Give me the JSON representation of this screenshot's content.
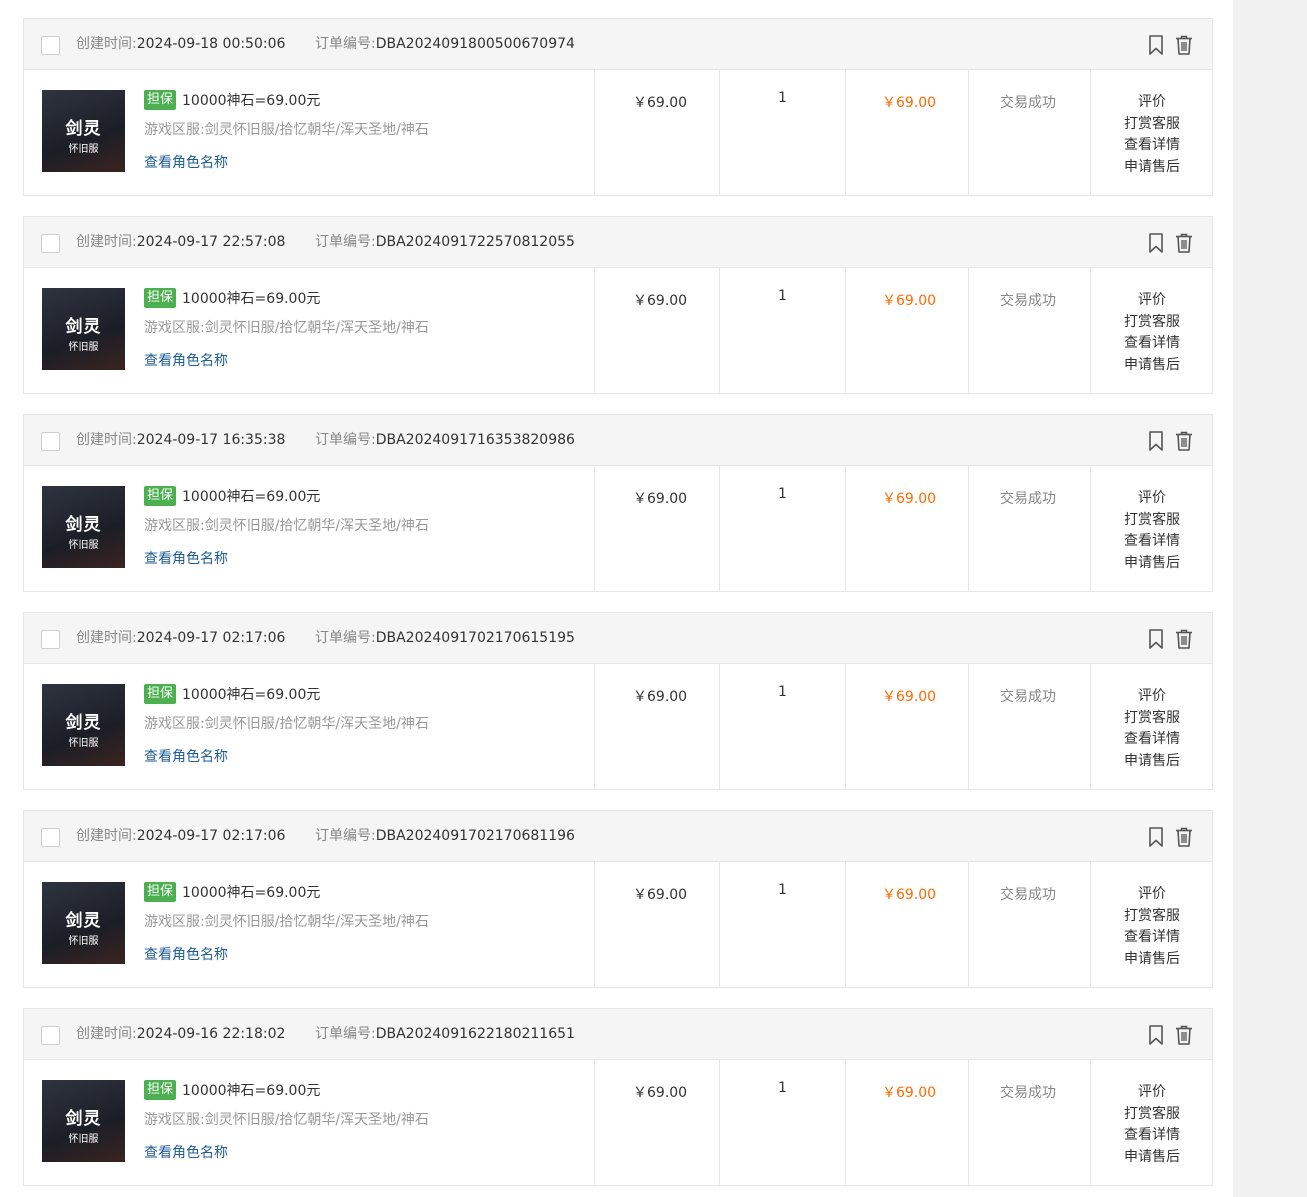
{
  "labels": {
    "created_time": "创建时间:",
    "order_no": "订单编号:",
    "guarantee_badge": "担保",
    "server_prefix": "游戏区服:",
    "view_role": "查看角色名称",
    "thumb_line1": "剑灵",
    "thumb_line2": "怀旧服"
  },
  "colors": {
    "accent_price": "#ff6a00",
    "link": "#1f5d99",
    "badge": "#4caf50"
  },
  "icons": {
    "bookmark": "bookmark-icon",
    "delete": "trash-icon"
  },
  "orders": [
    {
      "created_time": "2024-09-18 00:50:06",
      "order_no": "DBA2024091800500670974",
      "product_title": "10000神石=69.00元",
      "server": "剑灵怀旧服/拾忆朝华/浑天圣地/神石",
      "unit_price": "￥69.00",
      "quantity": "1",
      "total": "￥69.00",
      "status": "交易成功",
      "actions": [
        "评价",
        "打赏客服",
        "查看详情",
        "申请售后"
      ]
    },
    {
      "created_time": "2024-09-17 22:57:08",
      "order_no": "DBA2024091722570812055",
      "product_title": "10000神石=69.00元",
      "server": "剑灵怀旧服/拾忆朝华/浑天圣地/神石",
      "unit_price": "￥69.00",
      "quantity": "1",
      "total": "￥69.00",
      "status": "交易成功",
      "actions": [
        "评价",
        "打赏客服",
        "查看详情",
        "申请售后"
      ]
    },
    {
      "created_time": "2024-09-17 16:35:38",
      "order_no": "DBA2024091716353820986",
      "product_title": "10000神石=69.00元",
      "server": "剑灵怀旧服/拾忆朝华/浑天圣地/神石",
      "unit_price": "￥69.00",
      "quantity": "1",
      "total": "￥69.00",
      "status": "交易成功",
      "actions": [
        "评价",
        "打赏客服",
        "查看详情",
        "申请售后"
      ]
    },
    {
      "created_time": "2024-09-17 02:17:06",
      "order_no": "DBA2024091702170615195",
      "product_title": "10000神石=69.00元",
      "server": "剑灵怀旧服/拾忆朝华/浑天圣地/神石",
      "unit_price": "￥69.00",
      "quantity": "1",
      "total": "￥69.00",
      "status": "交易成功",
      "actions": [
        "评价",
        "打赏客服",
        "查看详情",
        "申请售后"
      ]
    },
    {
      "created_time": "2024-09-17 02:17:06",
      "order_no": "DBA2024091702170681196",
      "product_title": "10000神石=69.00元",
      "server": "剑灵怀旧服/拾忆朝华/浑天圣地/神石",
      "unit_price": "￥69.00",
      "quantity": "1",
      "total": "￥69.00",
      "status": "交易成功",
      "actions": [
        "评价",
        "打赏客服",
        "查看详情",
        "申请售后"
      ]
    },
    {
      "created_time": "2024-09-16 22:18:02",
      "order_no": "DBA2024091622180211651",
      "product_title": "10000神石=69.00元",
      "server": "剑灵怀旧服/拾忆朝华/浑天圣地/神石",
      "unit_price": "￥69.00",
      "quantity": "1",
      "total": "￥69.00",
      "status": "交易成功",
      "actions": [
        "评价",
        "打赏客服",
        "查看详情",
        "申请售后"
      ]
    }
  ]
}
